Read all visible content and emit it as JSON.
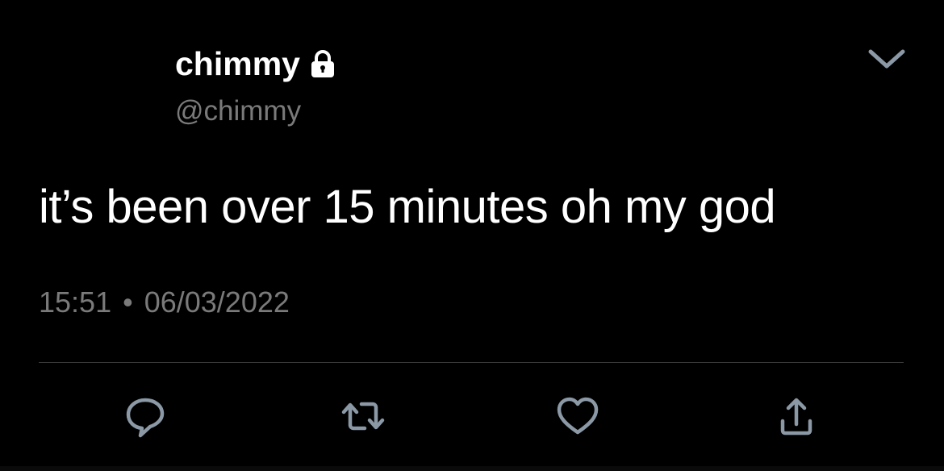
{
  "user": {
    "display_name": "chimmy",
    "handle": "@chimmy",
    "protected_icon": "lock-icon"
  },
  "tweet": {
    "text": "it’s been over 15 minutes oh my god",
    "time": "15:51",
    "separator": "•",
    "date": "06/03/2022"
  },
  "actions": {
    "reply_icon": "reply-icon",
    "retweet_icon": "retweet-icon",
    "like_icon": "heart-icon",
    "share_icon": "share-icon",
    "more_icon": "chevron-down-icon"
  },
  "colors": {
    "background": "#000000",
    "text": "#ffffff",
    "secondary": "#7a7a7a",
    "icon": "#8b98a5",
    "divider": "#3a3a3a"
  }
}
